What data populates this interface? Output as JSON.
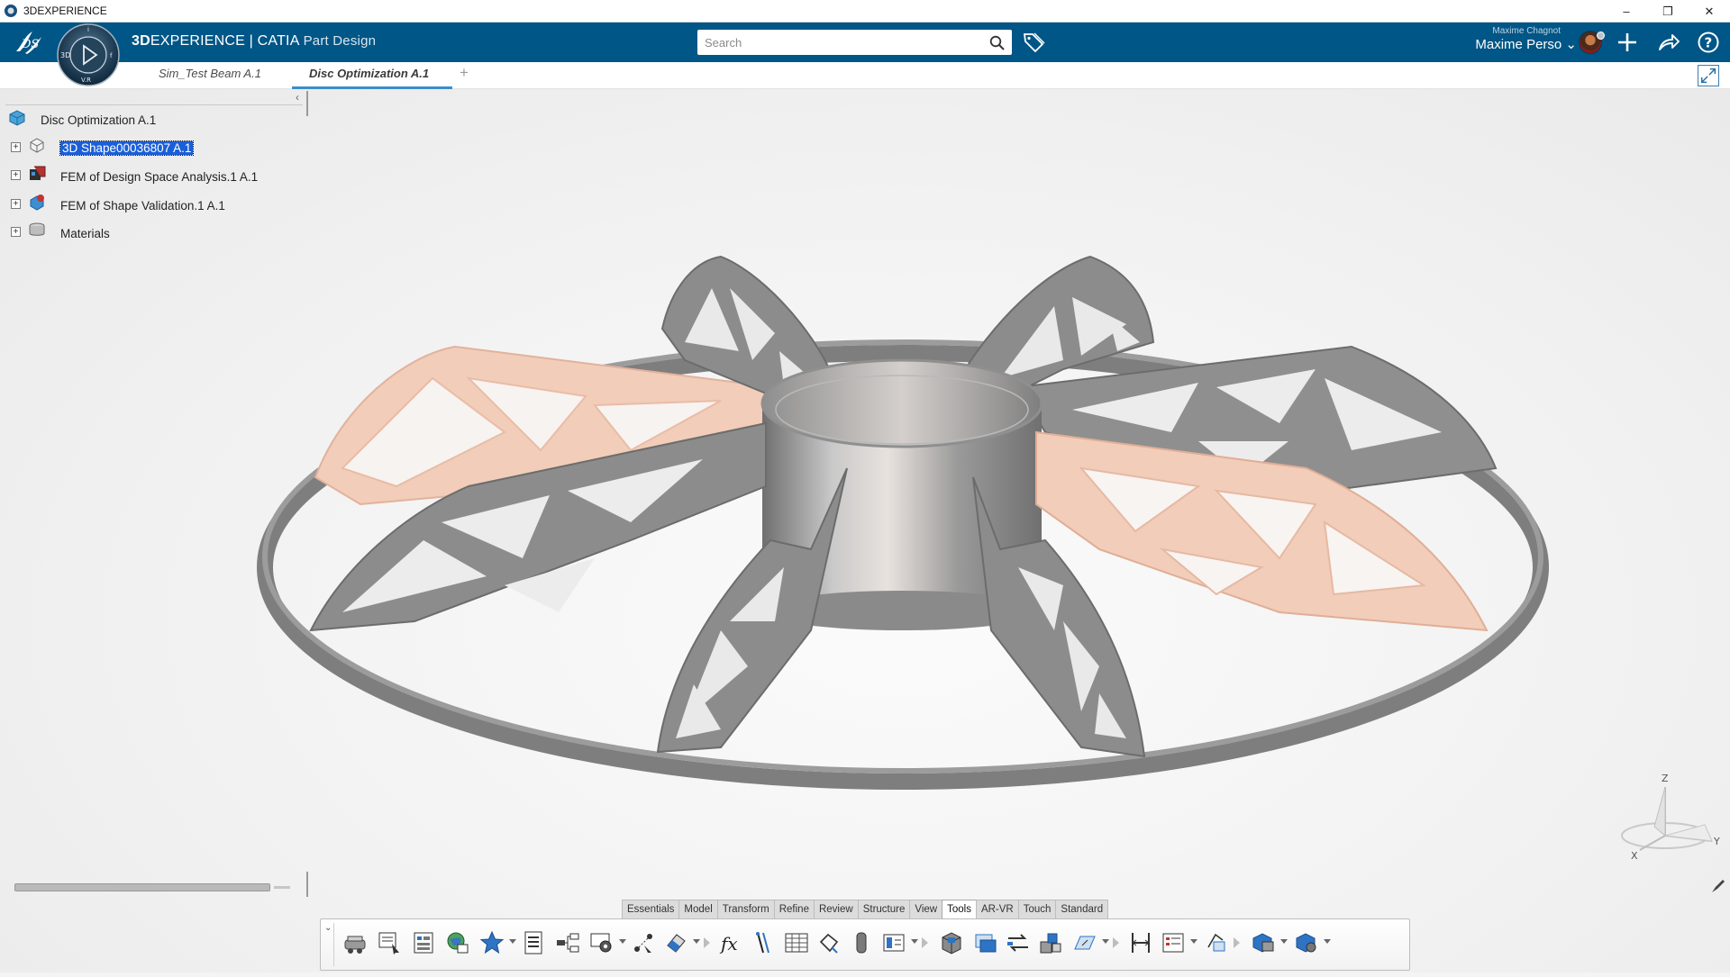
{
  "window": {
    "title": "3DEXPERIENCE",
    "minimize_glyph": "–",
    "restore_glyph": "❐",
    "close_glyph": "✕"
  },
  "header": {
    "brand_bold": "3D",
    "brand_rest": "EXPERIENCE | CATIA",
    "app_name": "Part Design",
    "search_placeholder": "Search",
    "user_small": "Maxime Chagnot",
    "user_name": "Maxime Perso ⌄",
    "compass_letters": [
      "3D",
      "V.R",
      "i",
      "f"
    ]
  },
  "tabs": [
    {
      "label": "Sim_Test Beam A.1",
      "active": false
    },
    {
      "label": "Disc Optimization A.1",
      "active": true
    }
  ],
  "tab_add": "+",
  "tree": {
    "collapse_glyph": "‹",
    "root": "Disc Optimization A.1",
    "items": [
      {
        "label": "3D Shape00036807 A.1",
        "selected": true,
        "icon": "3d-shape-icon"
      },
      {
        "label": "FEM of Design Space Analysis.1 A.1",
        "selected": false,
        "icon": "fem-icon"
      },
      {
        "label": "FEM of Shape Validation.1 A.1",
        "selected": false,
        "icon": "fem-icon"
      },
      {
        "label": "Materials",
        "selected": false,
        "icon": "materials-icon"
      }
    ]
  },
  "axis": {
    "x": "X",
    "y": "Y",
    "z": "Z"
  },
  "section_tabs": [
    "Essentials",
    "Model",
    "Transform",
    "Refine",
    "Review",
    "Structure",
    "View",
    "Tools",
    "AR-VR",
    "Touch",
    "Standard"
  ],
  "active_section": "Tools",
  "colors": {
    "header_blue": "#005686",
    "selection": "#1a5fd8",
    "tab_underline": "#3b8ec9",
    "part_gray": "#8c8c8c",
    "part_pink": "#f0c8b4"
  }
}
